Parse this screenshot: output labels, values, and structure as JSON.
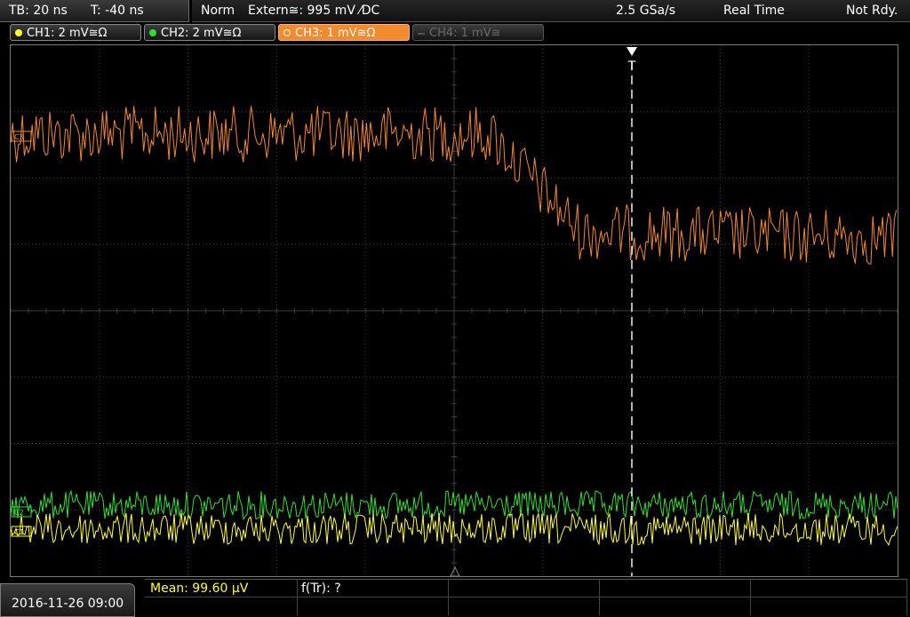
{
  "timebase": {
    "tb": "TB: 20 ns",
    "t": "T: -40 ns"
  },
  "status": {
    "mode": "Norm",
    "trigger": "Extern≅: 995 mV ⁄DC",
    "sample_rate": "2.5 GSa/s",
    "acq_mode": "Real Time",
    "state": "Not Rdy."
  },
  "channels": [
    {
      "label": "CH1: 2 mV≅Ω",
      "color": "#ffff30",
      "active": false,
      "enabled": true
    },
    {
      "label": "CH2: 2 mV≅Ω",
      "color": "#30e030",
      "active": false,
      "enabled": true
    },
    {
      "label": "CH3: 1 mV≅Ω",
      "color": "#f28a2e",
      "active": true,
      "enabled": true
    },
    {
      "label": "CH4: 1 mV≅",
      "color": "#5a5a5a",
      "active": false,
      "enabled": false
    }
  ],
  "trigger_marker": "T",
  "offset_markers": {
    "ch3": "C3",
    "ch2": "C2",
    "ch1": "C1"
  },
  "colors": {
    "ch1": "#ffff30",
    "ch2": "#30e030",
    "ch3": "#f28a2e",
    "grid": "#3c3c3c"
  },
  "datetime": "2016-11-26 09:00",
  "measurements": {
    "mean": "Mean: 99.60 µV",
    "ftr": "f(Tr): ?"
  }
}
